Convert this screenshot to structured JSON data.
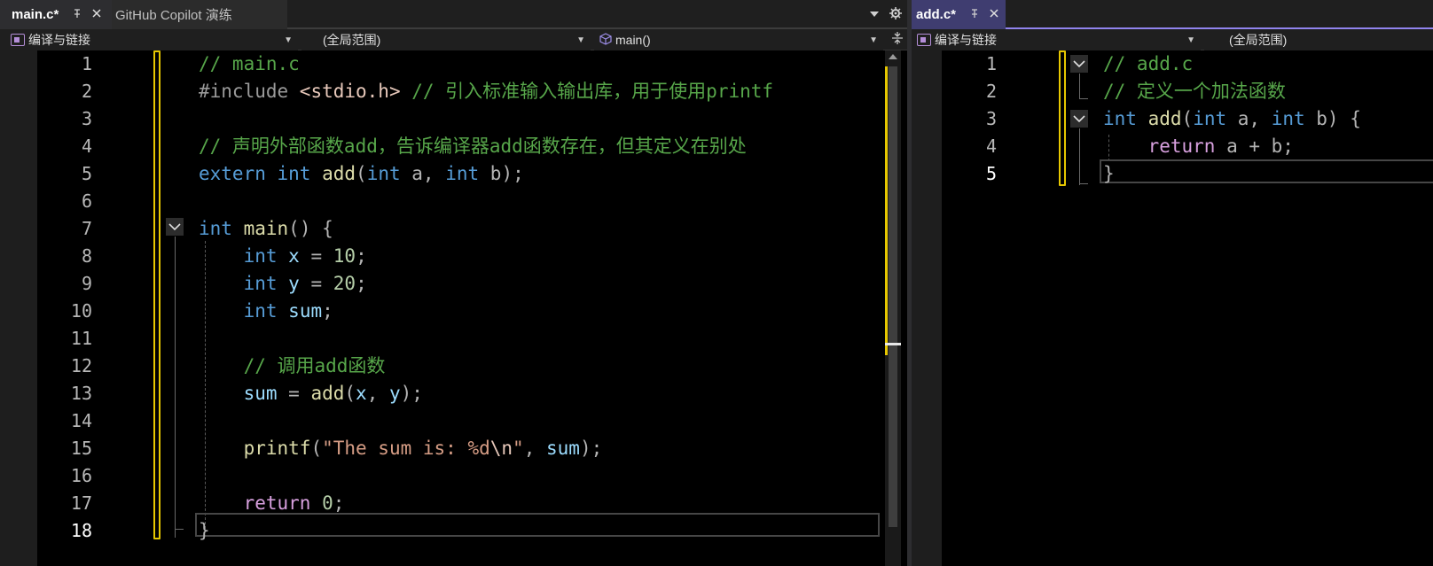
{
  "left": {
    "tabs": [
      {
        "label": "main.c*",
        "active": true
      },
      {
        "label": "GitHub Copilot 演练",
        "active": false
      }
    ],
    "nav": {
      "project": "编译与链接",
      "scope": "(全局范围)",
      "member": "main()"
    },
    "current_line": "18",
    "lines": [
      {
        "n": "1",
        "tokens": [
          [
            "cmt",
            "// main.c"
          ]
        ]
      },
      {
        "n": "2",
        "tokens": [
          [
            "pp",
            "#include "
          ],
          [
            "inc",
            "<stdio.h>"
          ],
          [
            "pun",
            " "
          ],
          [
            "cmt",
            "// 引入标准输入输出库，用于使用printf"
          ]
        ]
      },
      {
        "n": "3",
        "tokens": []
      },
      {
        "n": "4",
        "tokens": [
          [
            "cmt",
            "// 声明外部函数add，告诉编译器add函数存在，但其定义在别处"
          ]
        ]
      },
      {
        "n": "5",
        "tokens": [
          [
            "kw",
            "extern"
          ],
          [
            "pun",
            " "
          ],
          [
            "kw",
            "int"
          ],
          [
            "pun",
            " "
          ],
          [
            "fn",
            "add"
          ],
          [
            "pun",
            "("
          ],
          [
            "kw",
            "int"
          ],
          [
            "pun",
            " a, "
          ],
          [
            "kw",
            "int"
          ],
          [
            "pun",
            " b);"
          ]
        ]
      },
      {
        "n": "6",
        "tokens": []
      },
      {
        "n": "7",
        "tokens": [
          [
            "kw",
            "int"
          ],
          [
            "pun",
            " "
          ],
          [
            "fn",
            "main"
          ],
          [
            "pun",
            "() {"
          ]
        ]
      },
      {
        "n": "8",
        "tokens": [
          [
            "pun",
            "    "
          ],
          [
            "kw",
            "int"
          ],
          [
            "pun",
            " "
          ],
          [
            "var",
            "x"
          ],
          [
            "pun",
            " = "
          ],
          [
            "num",
            "10"
          ],
          [
            "pun",
            ";"
          ]
        ]
      },
      {
        "n": "9",
        "tokens": [
          [
            "pun",
            "    "
          ],
          [
            "kw",
            "int"
          ],
          [
            "pun",
            " "
          ],
          [
            "var",
            "y"
          ],
          [
            "pun",
            " = "
          ],
          [
            "num",
            "20"
          ],
          [
            "pun",
            ";"
          ]
        ]
      },
      {
        "n": "10",
        "tokens": [
          [
            "pun",
            "    "
          ],
          [
            "kw",
            "int"
          ],
          [
            "pun",
            " "
          ],
          [
            "var",
            "sum"
          ],
          [
            "pun",
            ";"
          ]
        ]
      },
      {
        "n": "11",
        "tokens": []
      },
      {
        "n": "12",
        "tokens": [
          [
            "pun",
            "    "
          ],
          [
            "cmt",
            "// 调用add函数"
          ]
        ]
      },
      {
        "n": "13",
        "tokens": [
          [
            "pun",
            "    "
          ],
          [
            "var",
            "sum"
          ],
          [
            "pun",
            " = "
          ],
          [
            "fn",
            "add"
          ],
          [
            "pun",
            "("
          ],
          [
            "var",
            "x"
          ],
          [
            "pun",
            ", "
          ],
          [
            "var",
            "y"
          ],
          [
            "pun",
            ");"
          ]
        ]
      },
      {
        "n": "14",
        "tokens": []
      },
      {
        "n": "15",
        "tokens": [
          [
            "pun",
            "    "
          ],
          [
            "fn",
            "printf"
          ],
          [
            "pun",
            "("
          ],
          [
            "str",
            "\"The sum is: %d"
          ],
          [
            "esc",
            "\\n"
          ],
          [
            "str",
            "\""
          ],
          [
            "pun",
            ", "
          ],
          [
            "var",
            "sum"
          ],
          [
            "pun",
            ");"
          ]
        ]
      },
      {
        "n": "16",
        "tokens": []
      },
      {
        "n": "17",
        "tokens": [
          [
            "pun",
            "    "
          ],
          [
            "ctl",
            "return"
          ],
          [
            "pun",
            " "
          ],
          [
            "num",
            "0"
          ],
          [
            "pun",
            ";"
          ]
        ]
      },
      {
        "n": "18",
        "tokens": [
          [
            "pun",
            "}"
          ]
        ]
      }
    ]
  },
  "right": {
    "tabs": [
      {
        "label": "add.c*",
        "active": true
      }
    ],
    "nav": {
      "project": "编译与链接",
      "scope": "(全局范围)"
    },
    "current_line": "5",
    "lines": [
      {
        "n": "1",
        "tokens": [
          [
            "cmt",
            "// add.c"
          ]
        ]
      },
      {
        "n": "2",
        "tokens": [
          [
            "cmt",
            "// 定义一个加法函数"
          ]
        ]
      },
      {
        "n": "3",
        "tokens": [
          [
            "kw",
            "int"
          ],
          [
            "pun",
            " "
          ],
          [
            "fn",
            "add"
          ],
          [
            "pun",
            "("
          ],
          [
            "kw",
            "int"
          ],
          [
            "pun",
            " a, "
          ],
          [
            "kw",
            "int"
          ],
          [
            "pun",
            " b) {"
          ]
        ]
      },
      {
        "n": "4",
        "tokens": [
          [
            "pun",
            "    "
          ],
          [
            "ctl",
            "return"
          ],
          [
            "pun",
            " a + b;"
          ]
        ]
      },
      {
        "n": "5",
        "tokens": [
          [
            "pun",
            "}"
          ]
        ]
      }
    ]
  },
  "icons": {
    "pin": "pin-icon",
    "close": "close-icon",
    "dropdown": "chevron-down-icon",
    "settings": "gear-icon",
    "split": "split-editor-icon",
    "project": "project-icon",
    "member": "cube-icon",
    "fold": "fold-chevron-icon"
  },
  "colors": {
    "comment": "#57a64a",
    "keyword": "#569cd6",
    "function": "#dcdcaa",
    "variable": "#9cdcfe",
    "number": "#b5cea8",
    "string": "#d69d85",
    "control": "#d8a0df",
    "change_bar": "#e6c700",
    "active_tab_accent": "#9184ee"
  }
}
